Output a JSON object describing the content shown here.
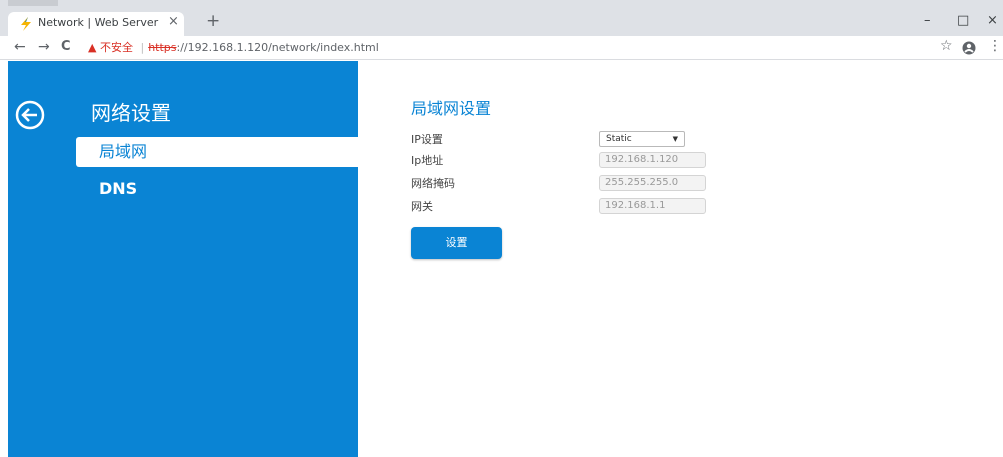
{
  "browser": {
    "tab_title": "Network | Web Server",
    "tab_close": "×",
    "new_tab": "+",
    "window_minimize": "–",
    "window_restore": "□",
    "window_close": "×",
    "nav_back": "←",
    "nav_forward": "→",
    "nav_reload": "C",
    "security_icon": "▲",
    "security_text": "不安全",
    "url_scheme": "https",
    "url_rest": "://192.168.1.120/network/index.html",
    "star": "☆",
    "menu": "⋮"
  },
  "sidebar": {
    "title": "网络设置",
    "items": [
      {
        "label": "局域网",
        "active": true
      },
      {
        "label": "DNS",
        "active": false
      }
    ]
  },
  "main": {
    "title": "局域网设置",
    "fields": [
      {
        "label": "IP设置",
        "value": "Static",
        "type": "select"
      },
      {
        "label": "Ip地址",
        "value": "192.168.1.120",
        "type": "text"
      },
      {
        "label": "网络掩码",
        "value": "255.255.255.0",
        "type": "text"
      },
      {
        "label": "网关",
        "value": "192.168.1.1",
        "type": "text"
      }
    ],
    "submit_label": "设置"
  },
  "colors": {
    "accent": "#0a84d4",
    "warning": "#d93025"
  },
  "icons": [
    "lightning-favicon-icon",
    "back-arrow-circle-icon",
    "bookmark-star-icon",
    "account-icon",
    "menu-kebab-icon",
    "warning-triangle-icon"
  ]
}
